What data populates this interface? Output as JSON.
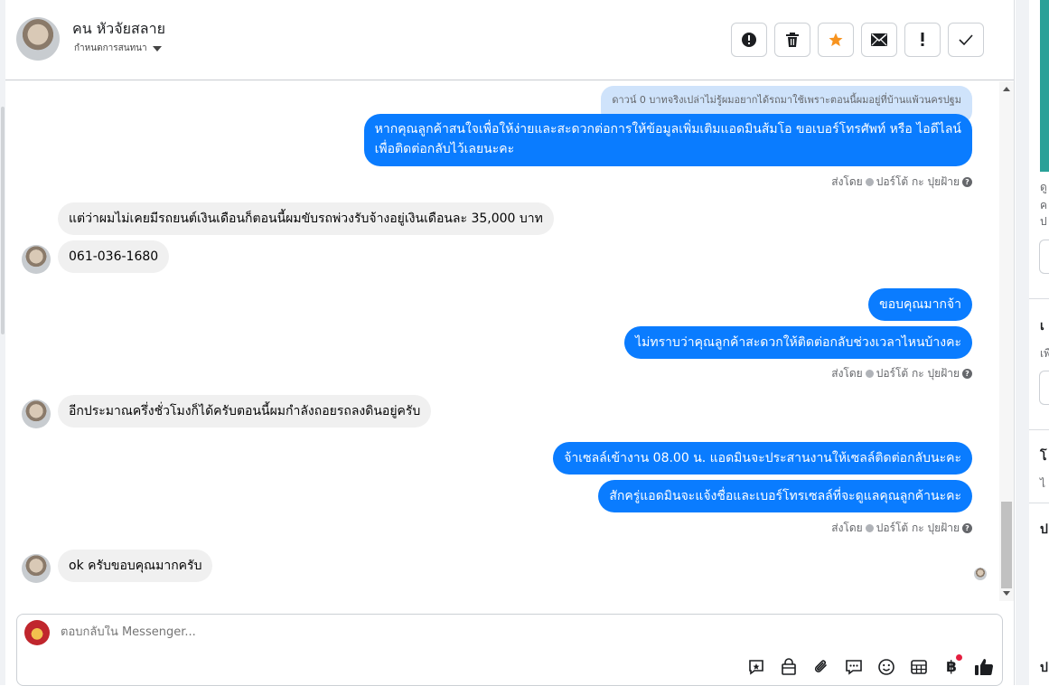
{
  "header": {
    "contact_name": "คน หัวจัยสลาย",
    "assign_label": "กำหนดการสนทนา",
    "actions": [
      {
        "name": "mark-spam-button",
        "icon": "exclamation-circle-icon"
      },
      {
        "name": "delete-button",
        "icon": "trash-icon"
      },
      {
        "name": "star-button",
        "icon": "star-icon"
      },
      {
        "name": "mark-unread-button",
        "icon": "envelope-icon"
      },
      {
        "name": "follow-up-button",
        "icon": "exclamation-icon"
      },
      {
        "name": "mark-done-button",
        "icon": "checkmark-icon"
      }
    ],
    "star_color": "#f7931e"
  },
  "messages": {
    "quoted_text": "ดาวน์ 0 บาทจริงเปล่าไม่รู้ผมอยากได้รถมาใช้เพราะตอนนี้ผมอยู่ที่บ้านแพ้วนครปฐม",
    "out1_line1": "หากคุณลูกค้าสนใจเพื่อให้ง่ายและสะดวกต่อการให้ข้อมูลเพิ่มเติมแอดมินส้มโอ ขอเบอร์โทรศัพท์ หรือ ไอดีไลน์",
    "out1_line2": "เพื่อติดต่อกลับไว้เลยนะคะ",
    "meta_prefix": "ส่งโดย",
    "meta_sender": "ปอร์โต้ กะ ปุยฝ้าย",
    "in1": "แต่ว่าผมไม่เคยมีรถยนต์เงินเดือนก็ตอนนี้ผมขับรถพ่วงรับจ้างอยู่เงินเดือนละ 35,000 บาท",
    "in2": "061-036-1680",
    "out2": "ขอบคุณมากจ้า",
    "out3": "ไม่ทราบว่าคุณลูกค้าสะดวกให้ติดต่อกลับช่วงเวลาไหนบ้างคะ",
    "in3": "อีกประมาณครึ่งชั่วโมงก็ได้ครับตอนนี้ผมกำลังถอยรถลงดินอยู่ครับ",
    "out4": "จ้าเซลล์เข้างาน 08.00 น. แอดมินจะประสานงานให้เซลล์ติดต่อกลับนะคะ",
    "out5": "สักครู่แอดมินจะแจ้งชื่อและเบอร์โทรเซลล์ที่จะดูแลคุณลูกค้านะคะ",
    "in4": "ok ครับขอบคุณมากครับ"
  },
  "composer": {
    "placeholder": "ตอบกลับใน Messenger...",
    "tools": [
      "saved-reply-icon",
      "shopping-bag-icon",
      "paperclip-icon",
      "chat-bubble-icon",
      "emoji-icon",
      "table-icon",
      "baht-icon",
      "thumbs-up-icon"
    ],
    "baht_symbol": "฿"
  },
  "right_panel": {
    "frag1": "ดู",
    "frag2": "ค",
    "frag3": "ป",
    "frag4": "เ",
    "frag5": "เพื",
    "frag6": "โ",
    "frag7": "ไ",
    "frag8": "ป",
    "frag9": "ป"
  },
  "colors": {
    "outgoing_bubble": "#0a7cff",
    "incoming_bubble": "#f0f0f0",
    "quoted_bubble": "#cfe3fb"
  }
}
